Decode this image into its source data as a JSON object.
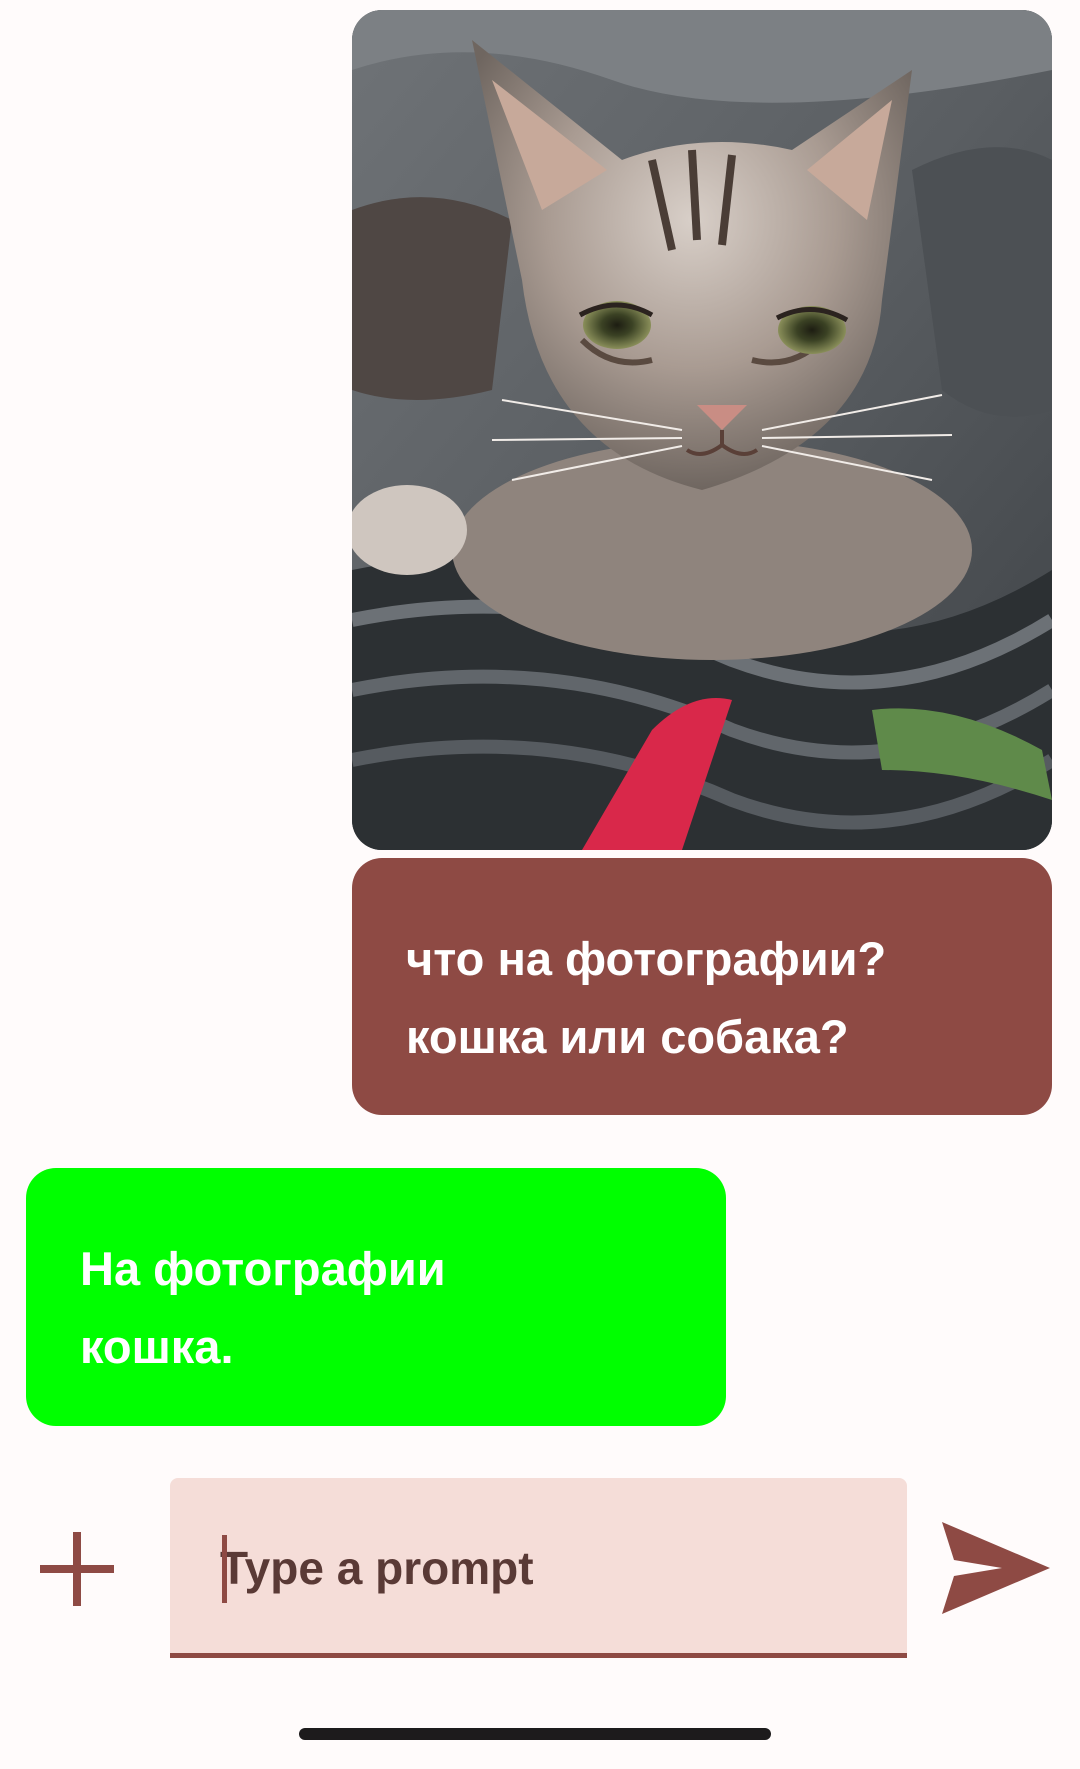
{
  "chat": {
    "photo_description": "tabby kitten lying on a dark striped blanket",
    "user_message": "что на фотографии?\nкошка или собака?",
    "assistant_message": " На фотографии\nкошка."
  },
  "composer": {
    "placeholder": "Type a prompt",
    "value": ""
  },
  "icons": {
    "add": "plus-icon",
    "send": "send-icon"
  },
  "colors": {
    "user_bubble": "#8e4a44",
    "assistant_bubble": "#00ff00",
    "composer_background": "#f5ddd8",
    "accent": "#8e4a44",
    "page_background": "#fffbfb"
  }
}
